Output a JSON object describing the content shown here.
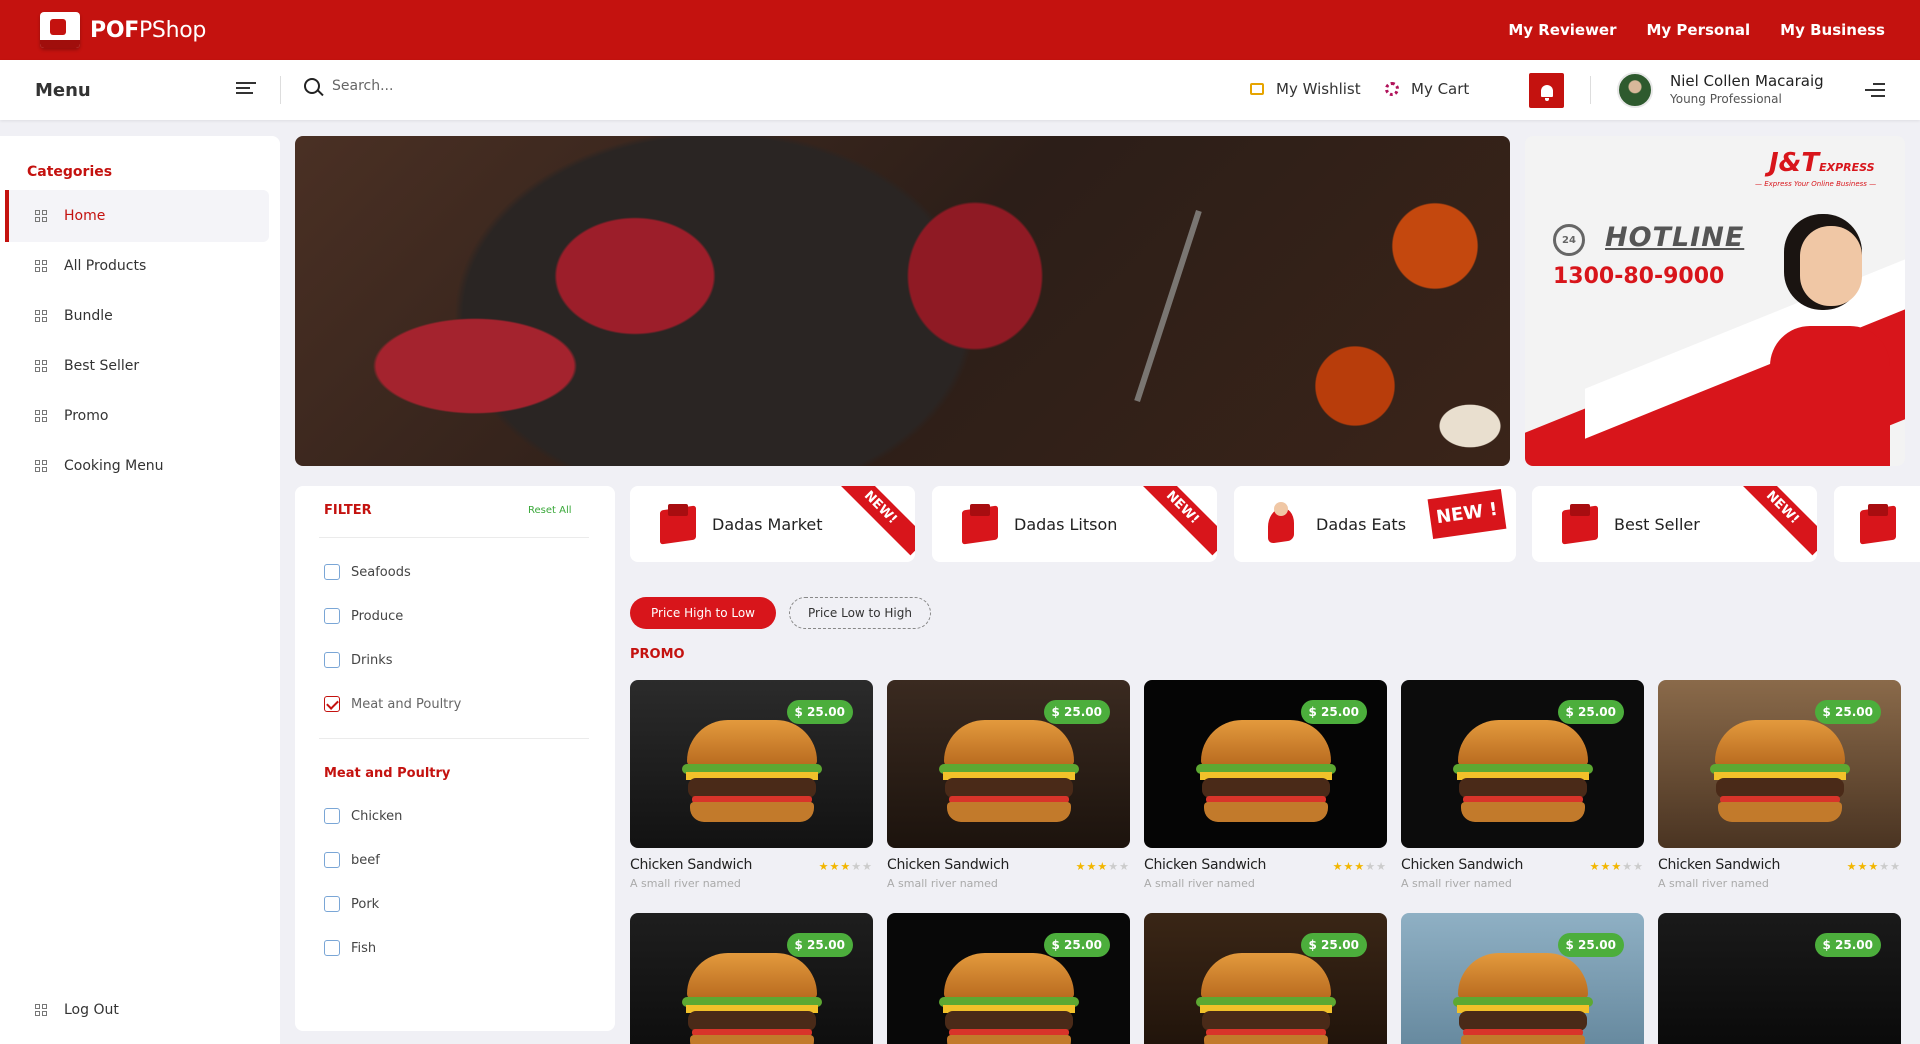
{
  "brand": {
    "name_bold": "POF",
    "name_rest": "PShop"
  },
  "top_links": [
    "My Reviewer",
    "My Personal",
    "My Business"
  ],
  "navbar": {
    "menu_label": "Menu",
    "search_placeholder": "Search...",
    "wishlist_label": "My Wishlist",
    "cart_label": "My Cart",
    "user_name": "Niel Collen Macaraig",
    "user_role": "Young Professional"
  },
  "sidebar": {
    "heading": "Categories",
    "items": [
      {
        "label": "Home",
        "active": true
      },
      {
        "label": "All Products",
        "active": false
      },
      {
        "label": "Bundle",
        "active": false
      },
      {
        "label": "Best Seller",
        "active": false
      },
      {
        "label": "Promo",
        "active": false
      },
      {
        "label": "Cooking Menu",
        "active": false
      }
    ],
    "logout_label": "Log Out"
  },
  "hotline_ad": {
    "logo": "J&T",
    "logo_suffix": "EXPRESS",
    "tagline": "— Express Your Online Business —",
    "icon_text": "24",
    "label": "HOTLINE",
    "number": "1300-80-9000"
  },
  "filter": {
    "title": "FILTER",
    "reset_label": "Reset All",
    "options": [
      {
        "label": "Seafoods",
        "checked": false
      },
      {
        "label": "Produce",
        "checked": false
      },
      {
        "label": "Drinks",
        "checked": false
      },
      {
        "label": "Meat and Poultry",
        "checked": true
      }
    ],
    "sub_title": "Meat and Poultry",
    "sub_options": [
      {
        "label": "Chicken",
        "checked": false
      },
      {
        "label": "beef",
        "checked": false
      },
      {
        "label": "Pork",
        "checked": false
      },
      {
        "label": "Fish",
        "checked": false
      }
    ]
  },
  "stores": [
    {
      "name": "Dadas Market",
      "badge": "NEW!"
    },
    {
      "name": "Dadas Litson",
      "badge": "NEW!"
    },
    {
      "name": "Dadas Eats",
      "badge": "NEW !"
    },
    {
      "name": "Best Seller",
      "badge": "NEW!"
    }
  ],
  "sort": {
    "high_to_low": "Price High to Low",
    "low_to_high": "Price Low to High",
    "selected": "Price High to Low"
  },
  "section_label": "PROMO",
  "products": [
    {
      "name": "Chicken Sandwich",
      "price": "$ 25.00",
      "rating": 3,
      "rating_max": 5,
      "desc": "A small river named"
    },
    {
      "name": "Chicken Sandwich",
      "price": "$ 25.00",
      "rating": 3,
      "rating_max": 5,
      "desc": "A small river named"
    },
    {
      "name": "Chicken Sandwich",
      "price": "$ 25.00",
      "rating": 3,
      "rating_max": 5,
      "desc": "A small river named"
    },
    {
      "name": "Chicken Sandwich",
      "price": "$ 25.00",
      "rating": 3,
      "rating_max": 5,
      "desc": "A small river named"
    },
    {
      "name": "Chicken Sandwich",
      "price": "$ 25.00",
      "rating": 3,
      "rating_max": 5,
      "desc": "A small river named"
    },
    {
      "name": "",
      "price": "$ 25.00",
      "rating": null,
      "rating_max": null,
      "desc": ""
    },
    {
      "name": "",
      "price": "$ 25.00",
      "rating": null,
      "rating_max": null,
      "desc": ""
    },
    {
      "name": "",
      "price": "$ 25.00",
      "rating": null,
      "rating_max": null,
      "desc": ""
    },
    {
      "name": "",
      "price": "$ 25.00",
      "rating": null,
      "rating_max": null,
      "desc": ""
    },
    {
      "name": "",
      "price": "$ 25.00",
      "rating": null,
      "rating_max": null,
      "desc": ""
    }
  ],
  "colors": {
    "brand_red": "#c4120f",
    "price_green": "#4cae3c",
    "star": "#f2b600"
  }
}
